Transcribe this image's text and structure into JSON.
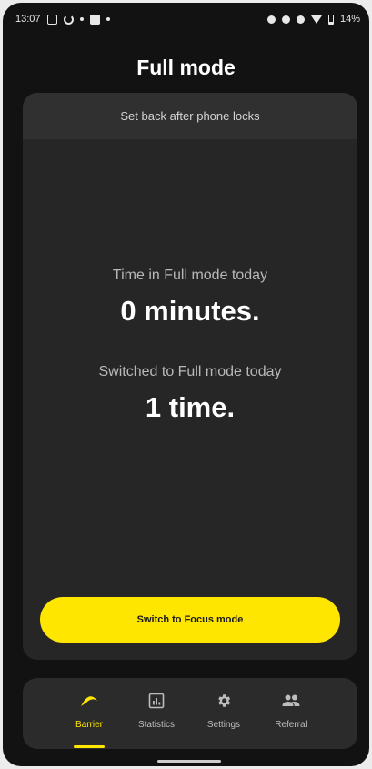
{
  "status_bar": {
    "time": "13:07",
    "battery": "14%"
  },
  "header": {
    "title": "Full mode"
  },
  "card": {
    "header_text": "Set back after phone locks",
    "time_label": "Time in Full mode today",
    "time_value": "0 minutes.",
    "switch_label": "Switched to Full mode today",
    "switch_value": "1 time.",
    "button_label": "Switch to Focus mode"
  },
  "nav": {
    "items": [
      {
        "label": "Barrier",
        "icon": "barrier-icon",
        "active": true
      },
      {
        "label": "Statistics",
        "icon": "statistics-icon",
        "active": false
      },
      {
        "label": "Settings",
        "icon": "gear-icon",
        "active": false
      },
      {
        "label": "Referral",
        "icon": "people-icon",
        "active": false
      }
    ]
  },
  "colors": {
    "accent": "#ffe600",
    "background": "#121212",
    "card": "#262626",
    "card_header": "#303030"
  }
}
